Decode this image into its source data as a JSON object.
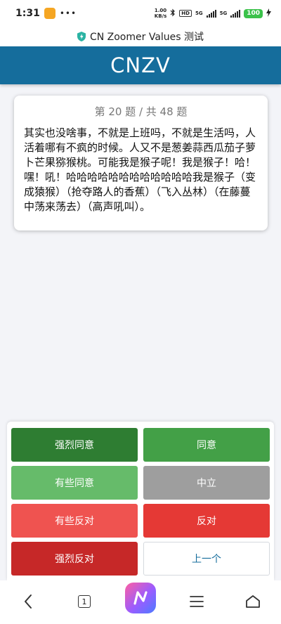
{
  "status_bar": {
    "time": "1:31",
    "net_speed_value": "1.00",
    "net_speed_unit": "KB/s",
    "hd_label": "HD",
    "net_type_1": "5G",
    "net_type_2": "5G",
    "battery": "100"
  },
  "browser": {
    "page_title": "CN Zoomer Values 测试"
  },
  "header": {
    "title": "CNZV"
  },
  "question": {
    "progress": "第 20 题 / 共 48 题",
    "text": "其实也没啥事，不就是上班吗，不就是生活吗，人活着哪有不疯的时候。人又不是葱姜蒜西瓜茄子萝卜芒果猕猴桃。可能我是猴子呢！我是猴子！哈！嘿！吼！哈哈哈哈哈哈哈哈哈哈哈哈我是猴子（变成猿猴）（抢夺路人的香蕉）（飞入丛林）（在藤蔓中荡来荡去）（高声吼叫）。"
  },
  "answers": {
    "strong_agree": "强烈同意",
    "agree": "同意",
    "somewhat_agree": "有些同意",
    "neutral": "中立",
    "somewhat_disagree": "有些反对",
    "disagree": "反对",
    "strong_disagree": "强烈反对",
    "previous": "上一个"
  },
  "bottom_nav": {
    "tab_count": "1"
  },
  "colors": {
    "header_bg": "#156d9c",
    "strong_agree": "#2e7d32",
    "agree": "#43a047",
    "somewhat_agree": "#66bb6a",
    "neutral": "#9e9e9e",
    "somewhat_disagree": "#ef5350",
    "disagree": "#e53935",
    "strong_disagree": "#c62828"
  },
  "icons": {
    "title_bar": "shield-icon",
    "nav_back": "chevron-left-icon",
    "nav_tabs": "tabs-icon",
    "nav_app": "browser-app-icon",
    "nav_menu": "menu-icon",
    "nav_home": "home-icon"
  }
}
